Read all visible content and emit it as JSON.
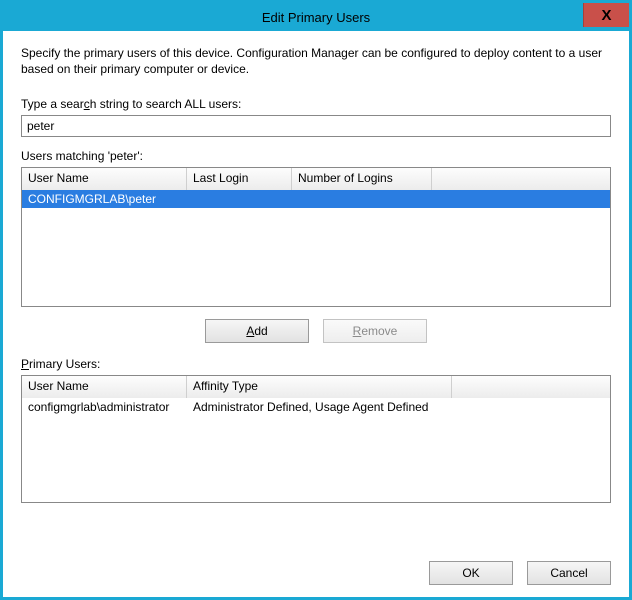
{
  "window": {
    "title": "Edit Primary Users",
    "close_icon": "X"
  },
  "description": "Specify the primary users of this device. Configuration Manager can be configured to deploy content to a user based on their primary computer or device.",
  "search": {
    "label_prefix": "Type a sear",
    "label_underlined": "c",
    "label_suffix": "h string to search ALL users:",
    "value": "peter"
  },
  "matching": {
    "label": "Users matching 'peter':",
    "columns": {
      "user": "User Name",
      "last_login": "Last Login",
      "num_logins": "Number of Logins"
    },
    "rows": [
      {
        "user": "CONFIGMGRLAB\\peter",
        "last_login": "",
        "num_logins": ""
      }
    ]
  },
  "buttons": {
    "add_u": "A",
    "add_rest": "dd",
    "remove_u": "R",
    "remove_rest": "emove",
    "ok": "OK",
    "cancel": "Cancel"
  },
  "primary": {
    "label_u": "P",
    "label_rest": "rimary Users:",
    "columns": {
      "user": "User Name",
      "affinity": "Affinity Type"
    },
    "rows": [
      {
        "user": "configmgrlab\\administrator",
        "affinity": "Administrator Defined, Usage Agent Defined"
      }
    ]
  }
}
